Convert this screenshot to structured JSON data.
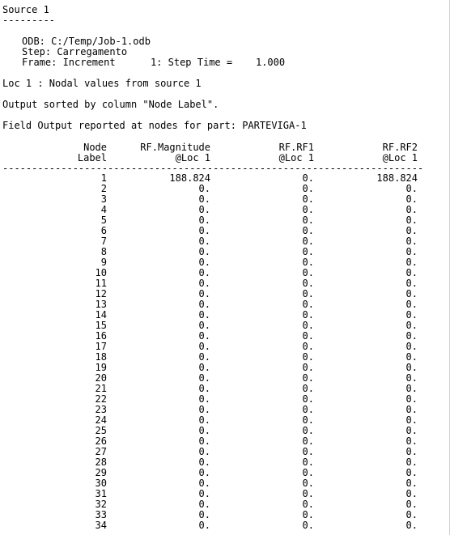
{
  "report": {
    "source_title": "Source 1",
    "source_rule": "---------",
    "odb_line": "ODB: C:/Temp/Job-1.odb",
    "step_line": "Step: Carregamento",
    "frame_line": "Frame: Increment      1: Step Time =    1.000",
    "loc_line": "Loc 1 : Nodal values from source 1",
    "sorted_line": "Output sorted by column \"Node Label\".",
    "field_line": "Field Output reported at nodes for part: PARTEVIGA-1"
  },
  "table": {
    "headers": [
      {
        "line1": "Node",
        "line2": "Label"
      },
      {
        "line1": "RF.Magnitude",
        "line2": "@Loc 1"
      },
      {
        "line1": "RF.RF1",
        "line2": "@Loc 1"
      },
      {
        "line1": "RF.RF2",
        "line2": "@Loc 1"
      }
    ],
    "separator": "----------------------------------------------------------------------------",
    "rows": [
      [
        "1",
        "188.824",
        "0.",
        "188.824"
      ],
      [
        "2",
        "0.",
        "0.",
        "0."
      ],
      [
        "3",
        "0.",
        "0.",
        "0."
      ],
      [
        "4",
        "0.",
        "0.",
        "0."
      ],
      [
        "5",
        "0.",
        "0.",
        "0."
      ],
      [
        "6",
        "0.",
        "0.",
        "0."
      ],
      [
        "7",
        "0.",
        "0.",
        "0."
      ],
      [
        "8",
        "0.",
        "0.",
        "0."
      ],
      [
        "9",
        "0.",
        "0.",
        "0."
      ],
      [
        "10",
        "0.",
        "0.",
        "0."
      ],
      [
        "11",
        "0.",
        "0.",
        "0."
      ],
      [
        "12",
        "0.",
        "0.",
        "0."
      ],
      [
        "13",
        "0.",
        "0.",
        "0."
      ],
      [
        "14",
        "0.",
        "0.",
        "0."
      ],
      [
        "15",
        "0.",
        "0.",
        "0."
      ],
      [
        "16",
        "0.",
        "0.",
        "0."
      ],
      [
        "17",
        "0.",
        "0.",
        "0."
      ],
      [
        "18",
        "0.",
        "0.",
        "0."
      ],
      [
        "19",
        "0.",
        "0.",
        "0."
      ],
      [
        "20",
        "0.",
        "0.",
        "0."
      ],
      [
        "21",
        "0.",
        "0.",
        "0."
      ],
      [
        "22",
        "0.",
        "0.",
        "0."
      ],
      [
        "23",
        "0.",
        "0.",
        "0."
      ],
      [
        "24",
        "0.",
        "0.",
        "0."
      ],
      [
        "25",
        "0.",
        "0.",
        "0."
      ],
      [
        "26",
        "0.",
        "0.",
        "0."
      ],
      [
        "27",
        "0.",
        "0.",
        "0."
      ],
      [
        "28",
        "0.",
        "0.",
        "0."
      ],
      [
        "29",
        "0.",
        "0.",
        "0."
      ],
      [
        "30",
        "0.",
        "0.",
        "0."
      ],
      [
        "31",
        "0.",
        "0.",
        "0."
      ],
      [
        "32",
        "0.",
        "0.",
        "0."
      ],
      [
        "33",
        "0.",
        "0.",
        "0."
      ],
      [
        "34",
        "0.",
        "0.",
        "0."
      ]
    ]
  }
}
